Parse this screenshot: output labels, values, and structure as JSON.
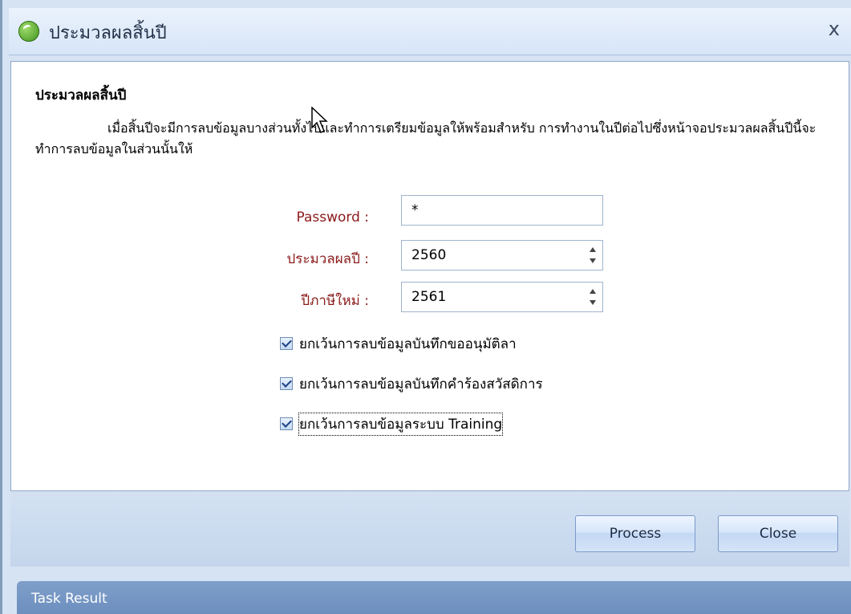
{
  "window": {
    "title": "ประมวลผลสิ้นปี",
    "close_label": "x"
  },
  "panel": {
    "heading": "ประมวลผลสิ้นปี",
    "description": "เมื่อสิ้นปีจะมีการลบข้อมูลบางส่วนทั้งไปและทำการเตรียมข้อมูลให้พร้อมสำหรับ การทำงานในปีต่อไปซึ่งหน้าจอประมวลผลสิ้นปีนี้จะทำการลบข้อมูลในส่วนนั้นให้"
  },
  "form": {
    "password_label": "Password :",
    "password_value": "*",
    "process_year_label": "ประมวลผลปี :",
    "process_year_value": "2560",
    "new_tax_year_label": "ปีภาษีใหม่ :",
    "new_tax_year_value": "2561"
  },
  "options": [
    {
      "label": "ยกเว้นการลบข้อมูลบันทึกขออนุมัติลา",
      "checked": true
    },
    {
      "label": "ยกเว้นการลบข้อมูลบันทึกคำร้องสวัสดิการ",
      "checked": true
    },
    {
      "label": "ยกเว้นการลบข้อมูลระบบ Training",
      "checked": true
    }
  ],
  "footer": {
    "process_label": "Process",
    "close_label": "Close"
  },
  "task_result": {
    "label": "Task Result"
  }
}
